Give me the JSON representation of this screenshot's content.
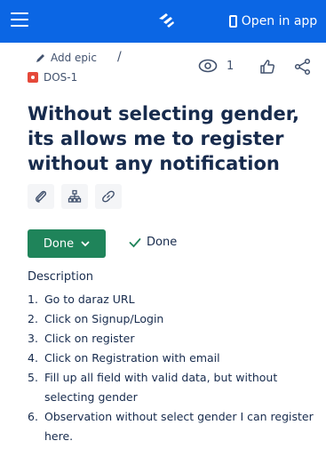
{
  "topbar": {
    "menu_icon": "hamburger-icon",
    "logo_icon": "jira-logo-icon",
    "open_app_label": "Open in app"
  },
  "breadcrumb": {
    "add_epic_label": "Add epic",
    "separator": "/",
    "issue_key": "DOS-1"
  },
  "actions": {
    "watchers_count": "1"
  },
  "issue": {
    "title": "Without selecting gender, its allows me to register without any notification",
    "status_label": "Done",
    "resolution_label": "Done"
  },
  "description": {
    "heading": "Description",
    "steps": [
      {
        "num": "1.",
        "text": "Go to daraz URL"
      },
      {
        "num": "2.",
        "text": "Click on Signup/Login"
      },
      {
        "num": "3.",
        "text": "Click on register"
      },
      {
        "num": "4.",
        "text": "Click on Registration with email"
      },
      {
        "num": "5.",
        "text": "Fill up all field with valid data, but without selecting gender"
      },
      {
        "num": "6.",
        "text": "Observation without select gender I can register here."
      }
    ]
  },
  "colors": {
    "topbar": "#0b66e4",
    "status_done": "#1f845a",
    "bug": "#e5493a"
  }
}
